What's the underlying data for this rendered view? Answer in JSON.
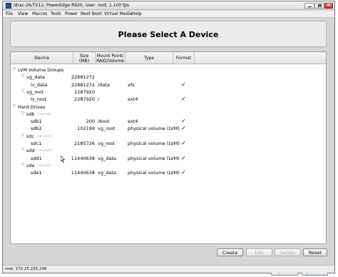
{
  "window": {
    "title": "idrac-26/TV12, PowerEdge R920, User: root, 1.100 fps"
  },
  "menu": [
    "File",
    "View",
    "Macros",
    "Tools",
    "Power",
    "Next Boot",
    "Virtual Media",
    "Help"
  ],
  "page": {
    "title": "Please Select A Device"
  },
  "table": {
    "headers": {
      "device": "Device",
      "size": "Size\n(MB)",
      "mount": "Mount Point/\nRAID/Volume",
      "type": "Type",
      "format": "Format"
    },
    "rows": [
      {
        "device": "LVM Volume Groups",
        "sub": "",
        "size": "",
        "mount": "",
        "type": "",
        "format": "",
        "level": 0,
        "expander": true
      },
      {
        "device": "vg_data",
        "sub": "",
        "size": "22881272",
        "mount": "",
        "type": "",
        "format": "",
        "level": 1,
        "expander": true
      },
      {
        "device": "lv_data",
        "sub": "",
        "size": "22881272",
        "mount": "/data",
        "type": "xfs",
        "format": "✓",
        "level": 2,
        "expander": false
      },
      {
        "device": "vg_root",
        "sub": "",
        "size": "2287920",
        "mount": "",
        "type": "",
        "format": "",
        "level": 1,
        "expander": true
      },
      {
        "device": "lv_root",
        "sub": "",
        "size": "2287920",
        "mount": "/",
        "type": "ext4",
        "format": "✓",
        "level": 2,
        "expander": false
      },
      {
        "device": "Hard Drives",
        "sub": "",
        "size": "",
        "mount": "",
        "type": "",
        "format": "",
        "level": 0,
        "expander": true
      },
      {
        "device": "sdb",
        "sub": "(/dev/sdb)",
        "size": "",
        "mount": "",
        "type": "",
        "format": "",
        "level": 1,
        "expander": true
      },
      {
        "device": "sdb1",
        "sub": "",
        "size": "200",
        "mount": "/boot",
        "type": "ext4",
        "format": "✓",
        "level": 2,
        "expander": false
      },
      {
        "device": "sdb2",
        "sub": "",
        "size": "102199",
        "mount": "vg_root",
        "type": "physical volume (LVM)",
        "format": "✓",
        "level": 2,
        "expander": false
      },
      {
        "device": "sdc",
        "sub": "(/dev/sdc)",
        "size": "",
        "mount": "",
        "type": "",
        "format": "",
        "level": 1,
        "expander": true
      },
      {
        "device": "sdc1",
        "sub": "",
        "size": "2185726",
        "mount": "vg_root",
        "type": "physical volume (LVM)",
        "format": "✓",
        "level": 2,
        "expander": false
      },
      {
        "device": "sdd",
        "sub": "(/dev/sdd)",
        "size": "",
        "mount": "",
        "type": "",
        "format": "",
        "level": 1,
        "expander": true
      },
      {
        "device": "sdd1",
        "sub": "",
        "size": "11440638",
        "mount": "vg_data",
        "type": "physical volume (LVM)",
        "format": "✓",
        "level": 2,
        "expander": false
      },
      {
        "device": "sde",
        "sub": "(/dev/sde)",
        "size": "",
        "mount": "",
        "type": "",
        "format": "",
        "level": 1,
        "expander": true
      },
      {
        "device": "sde1",
        "sub": "",
        "size": "11440638",
        "mount": "vg_data",
        "type": "physical volume (LVM)",
        "format": "✓",
        "level": 2,
        "expander": false
      }
    ]
  },
  "buttons": {
    "create": "Create",
    "edit": "Edit",
    "delete": "Delete",
    "reset": "Reset",
    "back": "Back",
    "next": "Next"
  },
  "icons": {
    "back": "back-arrow-icon",
    "next": "next-arrow-icon",
    "check": "checkmark-icon"
  },
  "status": {
    "text": "root: 172.25.225.236"
  }
}
